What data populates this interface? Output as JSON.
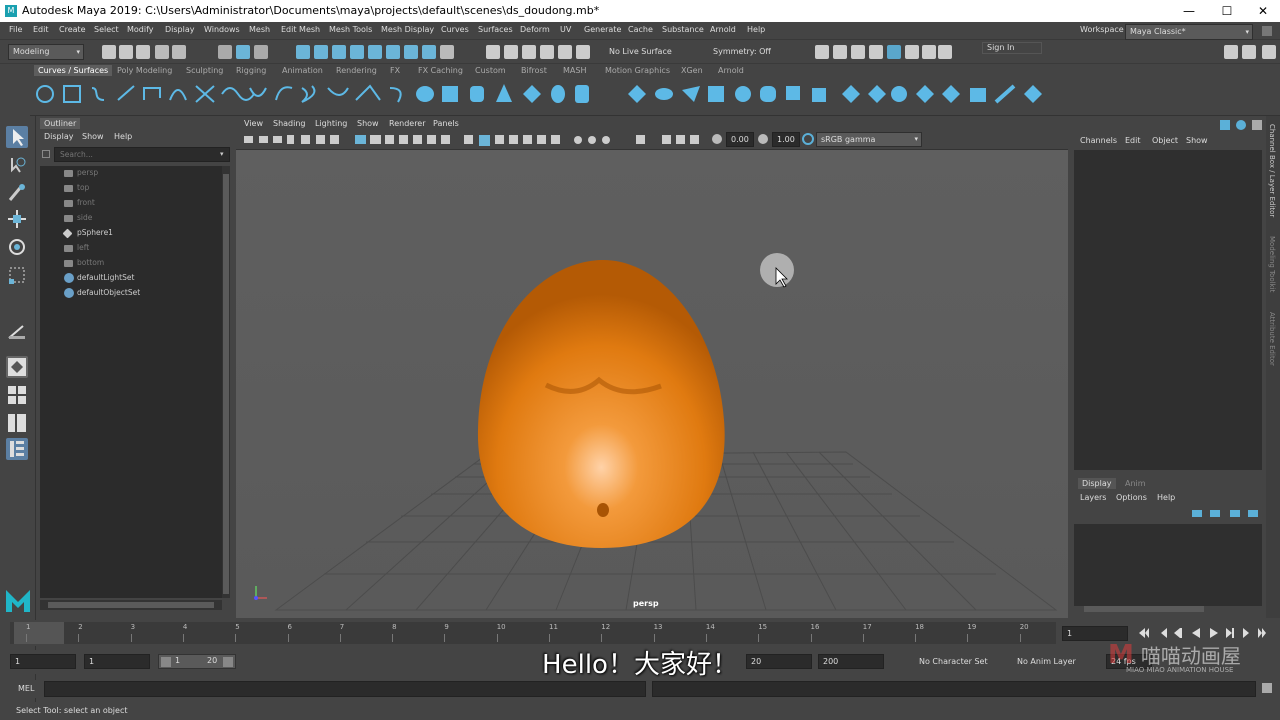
{
  "window": {
    "title": "Autodesk Maya 2019: C:\\Users\\Administrator\\Documents\\maya\\projects\\default\\scenes\\ds_doudong.mb*",
    "minimize": "—",
    "maximize": "☐",
    "close": "✕"
  },
  "menubar": {
    "items": [
      "File",
      "Edit",
      "Create",
      "Select",
      "Modify",
      "Display",
      "Windows",
      "Mesh",
      "Edit Mesh",
      "Mesh Tools",
      "Mesh Display",
      "Curves",
      "Surfaces",
      "Deform",
      "UV",
      "Generate",
      "Cache",
      "Substance",
      "Arnold",
      "Help"
    ],
    "workspace_label": "Workspace :",
    "workspace_value": "Maya Classic*"
  },
  "statusline": {
    "mode": "Modeling",
    "live_surface": "No Live Surface",
    "symmetry": "Symmetry: Off",
    "sign_in": "Sign In"
  },
  "shelf": {
    "tabs": [
      "Curves / Surfaces",
      "Poly Modeling",
      "Sculpting",
      "Rigging",
      "Animation",
      "Rendering",
      "FX",
      "FX Caching",
      "Custom",
      "Bifrost",
      "MASH",
      "Motion Graphics",
      "XGen",
      "Arnold"
    ],
    "active_tab": "Curves / Surfaces"
  },
  "outliner": {
    "title": "Outliner",
    "menu": [
      "Display",
      "Show",
      "Help"
    ],
    "search_placeholder": "Search...",
    "items": [
      "persp",
      "top",
      "front",
      "side",
      "pSphere1",
      "left",
      "bottom",
      "defaultLightSet",
      "defaultObjectSet"
    ]
  },
  "viewport": {
    "menu": [
      "View",
      "Shading",
      "Lighting",
      "Show",
      "Renderer",
      "Panels"
    ],
    "exposure": "0.00",
    "gamma": "1.00",
    "color_space": "sRGB gamma",
    "camera_label": "persp",
    "object_color": "#e07a10"
  },
  "channel_box": {
    "menu": [
      "Channels",
      "Edit",
      "Object",
      "Show"
    ],
    "layer_tabs": [
      "Display",
      "Anim"
    ],
    "layer_menu": [
      "Layers",
      "Options",
      "Help"
    ],
    "side_tabs": [
      "Channel Box / Layer Editor",
      "Modeling Toolkit",
      "Attribute Editor"
    ]
  },
  "timeline": {
    "ticks": [
      "1",
      "2",
      "3",
      "4",
      "5",
      "6",
      "7",
      "8",
      "9",
      "10",
      "11",
      "12",
      "13",
      "14",
      "15",
      "16",
      "17",
      "18",
      "19",
      "20"
    ],
    "current_frame": "1",
    "range_start": "1",
    "playback_start": "1",
    "slider_start": "1",
    "slider_end": "20",
    "playback_end": "20",
    "range_end": "200",
    "character_set": "No Character Set",
    "anim_layer": "No Anim Layer",
    "fps": "24 fps"
  },
  "mel": {
    "label": "MEL"
  },
  "helpline": {
    "text": "Select Tool: select an object"
  },
  "overlay": {
    "subtitle": "Hello！大家好！",
    "watermark_cn": "喵喵动画屋",
    "watermark_en": "MIAO MIAO ANIMATION HOUSE"
  }
}
